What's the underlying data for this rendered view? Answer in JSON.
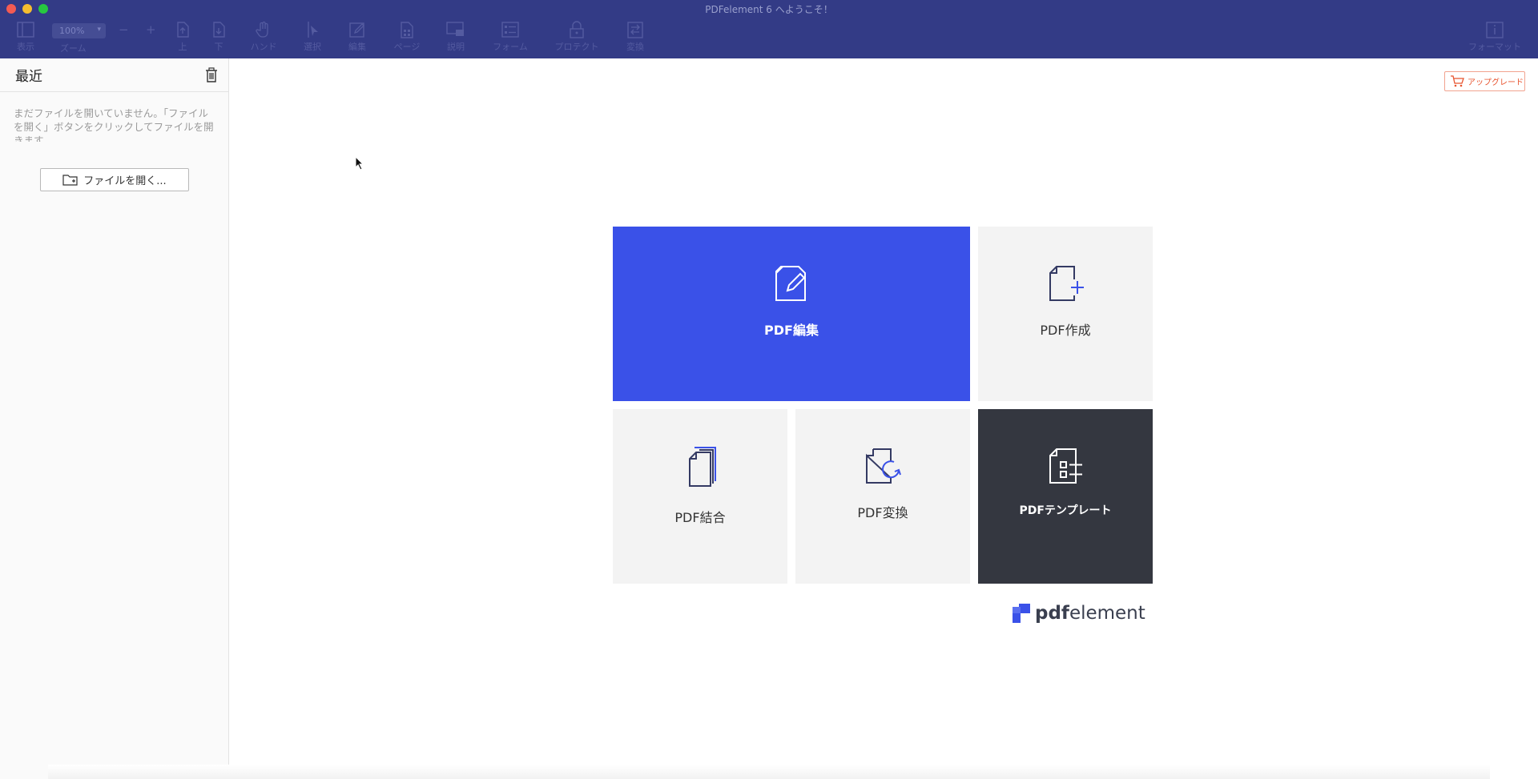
{
  "window": {
    "title": "PDFelement 6 へようこそ！"
  },
  "toolbar": {
    "view_label": "表示",
    "zoom_value": "100%",
    "zoom_label": "ズーム",
    "zoom_out": "−",
    "zoom_in": "+",
    "up_label": "上",
    "down_label": "下",
    "hand_label": "ハンド",
    "select_label": "選択",
    "edit_label": "編集",
    "page_label": "ページ",
    "comment_label": "説明",
    "form_label": "フォーム",
    "protect_label": "プロテクト",
    "convert_label": "変換",
    "format_label": "フォーマット"
  },
  "sidebar": {
    "title": "最近",
    "empty_message": "まだファイルを開いていません。「ファイルを開く」ボタンをクリックしてファイルを開きます",
    "open_button": "ファイルを開く..."
  },
  "upgrade": {
    "label": "アップグレード"
  },
  "tiles": {
    "edit": "PDF編集",
    "create": "PDF作成",
    "combine": "PDF結合",
    "convert": "PDF変換",
    "template": "PDFテンプレート"
  },
  "logo": {
    "bold": "pdf",
    "rest": "element"
  },
  "colors": {
    "toolbar_bg": "#333b86",
    "accent_blue": "#3a51e8",
    "template_dark": "#343740",
    "upgrade_orange": "#e8542f"
  }
}
